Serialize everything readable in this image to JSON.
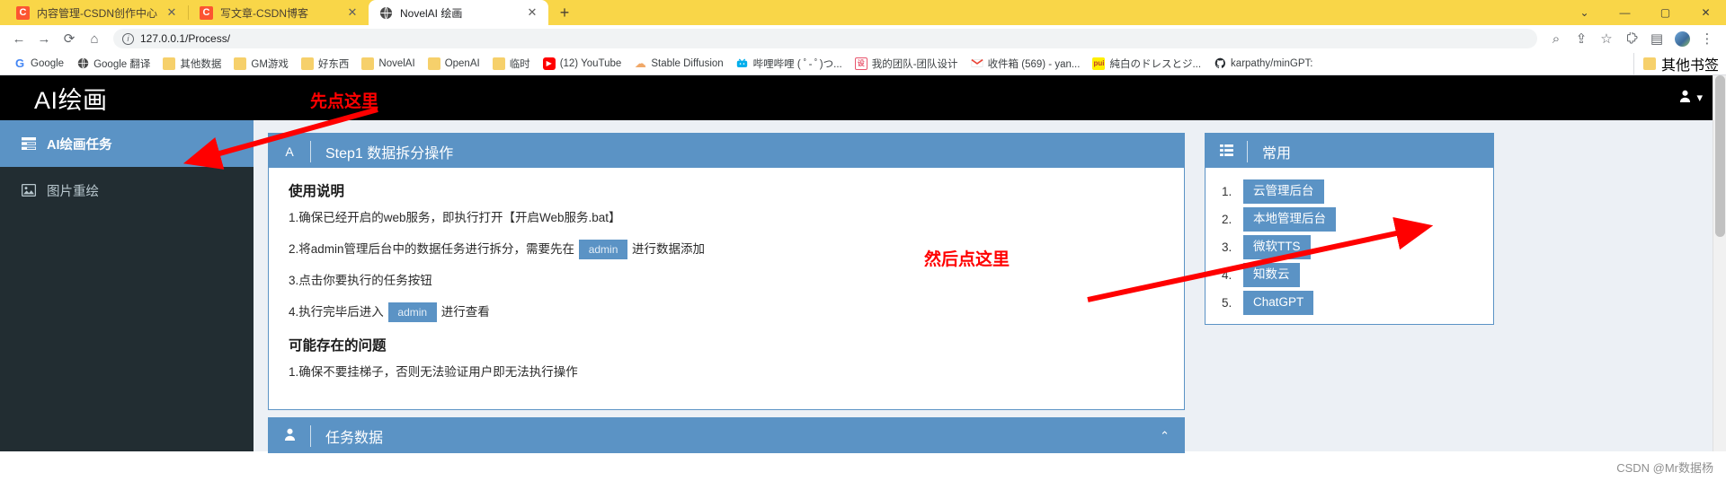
{
  "browser": {
    "tabs": [
      {
        "title": "内容管理-CSDN创作中心",
        "favicon": "csdn-icon",
        "active": false,
        "close": "✕"
      },
      {
        "title": "写文章-CSDN博客",
        "favicon": "csdn-icon",
        "active": false,
        "close": "✕"
      },
      {
        "title": "NovelAI 绘画",
        "favicon": "globe-icon",
        "active": true,
        "close": "✕"
      }
    ],
    "new_tab_label": "+",
    "window_controls": {
      "minimize": "⌄",
      "restore": "—",
      "maximize": "▢",
      "close": "✕"
    },
    "nav": {
      "back": "←",
      "forward": "→",
      "reload": "⟳",
      "home": "⌂"
    },
    "omnibox": {
      "info": "i",
      "url": "127.0.0.1/Process/",
      "zoom_icon": "⌕",
      "share_icon": "⇪",
      "star_icon": "☆",
      "extensions_icon": "🧩",
      "sidepanel_icon": "▤",
      "menu_icon": "⋮"
    },
    "bookmarks": [
      {
        "label": "Google",
        "icon": "google-icon",
        "style": "ico-google",
        "glyph": "G"
      },
      {
        "label": "Google 翻译",
        "icon": "globe-icon",
        "style": "ico-globe",
        "glyph": "🌐"
      },
      {
        "label": "其他数据",
        "icon": "folder-icon",
        "style": "ico-folder",
        "glyph": ""
      },
      {
        "label": "GM游戏",
        "icon": "folder-icon",
        "style": "ico-folder",
        "glyph": ""
      },
      {
        "label": "好东西",
        "icon": "folder-icon",
        "style": "ico-folder",
        "glyph": ""
      },
      {
        "label": "NovelAI",
        "icon": "folder-icon",
        "style": "ico-folder",
        "glyph": ""
      },
      {
        "label": "OpenAI",
        "icon": "folder-icon",
        "style": "ico-folder",
        "glyph": ""
      },
      {
        "label": "临时",
        "icon": "folder-icon",
        "style": "ico-folder",
        "glyph": ""
      },
      {
        "label": "(12) YouTube",
        "icon": "youtube-icon",
        "style": "ico-yt",
        "glyph": "▶"
      },
      {
        "label": "Stable Diffusion",
        "icon": "cloud-icon",
        "style": "ico-sd",
        "glyph": "☁"
      },
      {
        "label": "哔哩哔哩 ( ﾟ- ﾟ)つ...",
        "icon": "bilibili-icon",
        "style": "ico-bili",
        "glyph": "📺"
      },
      {
        "label": "我的团队-团队设计",
        "icon": "team-icon",
        "style": "ico-team",
        "glyph": "设"
      },
      {
        "label": "收件箱 (569) - yan...",
        "icon": "gmail-icon",
        "style": "ico-gmail",
        "glyph": "✉"
      },
      {
        "label": "純白のドレスとジ...",
        "icon": "pui-icon",
        "style": "ico-pui",
        "glyph": "pui"
      },
      {
        "label": "karpathy/minGPT:",
        "icon": "github-icon",
        "style": "ico-gh",
        "glyph": "⬤"
      }
    ],
    "bookmarks_overflow": {
      "label": "其他书签",
      "icon": "folder-icon"
    }
  },
  "app": {
    "brand": "AI绘画",
    "sidebar": {
      "items": [
        {
          "label": "AI绘画任务",
          "icon": "tasks-icon",
          "glyph": "▤",
          "active": true
        },
        {
          "label": "图片重绘",
          "icon": "image-icon",
          "glyph": "🖼",
          "active": false
        }
      ]
    },
    "topbar": {
      "user_icon": "user-icon",
      "user_caret": "▾"
    },
    "main": {
      "step_box": {
        "badge": "A",
        "title": "Step1 数据拆分操作",
        "usage_heading": "使用说明",
        "usage_steps": [
          {
            "prefix": "1.确保已经开启的web服务，即执行打开【开启Web服务.bat】",
            "chip": "",
            "suffix": ""
          },
          {
            "prefix": "2.将admin管理后台中的数据任务进行拆分，需要先在",
            "chip": "admin",
            "suffix": "进行数据添加"
          },
          {
            "prefix": "3.点击你要执行的任务按钮",
            "chip": "",
            "suffix": ""
          },
          {
            "prefix": "4.执行完毕后进入",
            "chip": "admin",
            "suffix": "进行查看"
          }
        ],
        "problems_heading": "可能存在的问题",
        "problems": [
          {
            "prefix": "1.确保不要挂梯子，否则无法验证用户即无法执行操作",
            "chip": "",
            "suffix": ""
          }
        ]
      },
      "task_box": {
        "badge_icon": "user-icon",
        "title": "任务数据",
        "collapse_icon": "⌃"
      }
    },
    "right_panel": {
      "badge_icon": "list-icon",
      "title": "常用",
      "links": [
        {
          "num": "1.",
          "label": "云管理后台"
        },
        {
          "num": "2.",
          "label": "本地管理后台"
        },
        {
          "num": "3.",
          "label": "微软TTS"
        },
        {
          "num": "4.",
          "label": "知数云"
        },
        {
          "num": "5.",
          "label": "ChatGPT"
        }
      ]
    },
    "annotations": [
      {
        "text": "先点这里",
        "color": "#ff0000"
      },
      {
        "text": "然后点这里",
        "color": "#ff0000"
      }
    ],
    "watermark": "CSDN @Mr数据杨"
  },
  "colors": {
    "tab_bar": "#f9d648",
    "accent_blue": "#5b93c5",
    "sidebar_dark": "#222d32",
    "header_black": "#000000",
    "page_bg": "#ecf0f5",
    "annotation_red": "#ff0000"
  }
}
